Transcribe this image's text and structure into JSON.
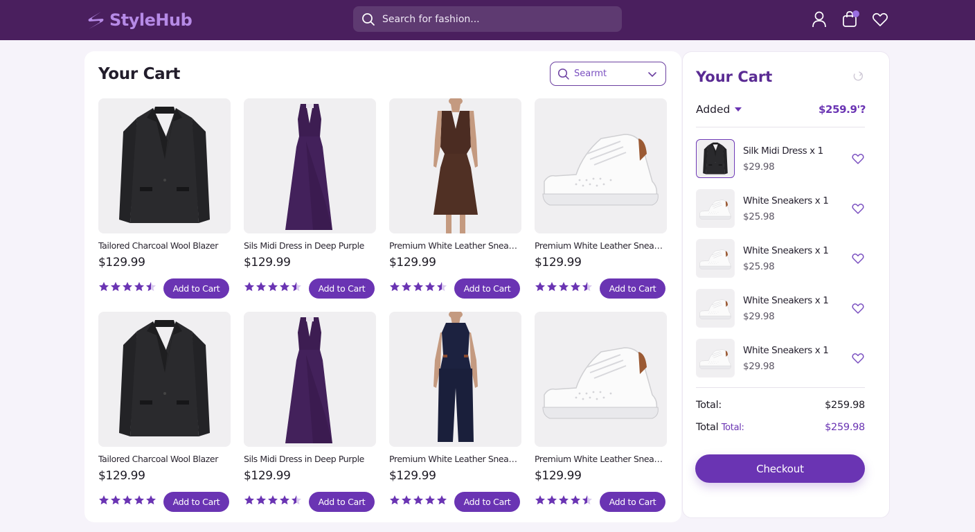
{
  "brand": {
    "name": "StyleHub",
    "accent": "#6a34b3",
    "header_bg": "#4a1f5e"
  },
  "search": {
    "placeholder": "Search for fashion..."
  },
  "header_icons": [
    "user-icon",
    "shopping-bag-icon",
    "heart-icon"
  ],
  "cart_page": {
    "title": "Your Cart",
    "sort_label": "Searmt",
    "products": [
      {
        "name": "Tailored Charcoal Wool Blazer",
        "price": "$129.99",
        "rating": 4.5,
        "image": "blazer",
        "button": "Add to Cart"
      },
      {
        "name": "Sils Midi Dress in Deep Purple",
        "price": "$129.99",
        "rating": 4.5,
        "image": "purple-dress",
        "button": "Add to Cart"
      },
      {
        "name": "Premium White Leather Sneaker...",
        "price": "$129.99",
        "rating": 4.5,
        "image": "brown-dress",
        "button": "Add to Cart"
      },
      {
        "name": "Premium White Leather Sneaker...",
        "price": "$129.99",
        "rating": 4.5,
        "image": "sneaker",
        "button": "Add to Cart"
      },
      {
        "name": "Tailored Charcoal Wool Blazer",
        "price": "$129.99",
        "rating": 5,
        "image": "blazer",
        "button": "Add to Cart"
      },
      {
        "name": "Sils Midi Dress in Deep Purple",
        "price": "$129.99",
        "rating": 4.5,
        "image": "purple-dress",
        "button": "Add to Cart"
      },
      {
        "name": "Premium White Leather Sneaker...",
        "price": "$129.99",
        "rating": 5,
        "image": "navy-outfit",
        "button": "Add to Cart"
      },
      {
        "name": "Premium White Leather Sneaker...",
        "price": "$129.99",
        "rating": 4.5,
        "image": "sneaker",
        "button": "Add to Cart"
      }
    ]
  },
  "side_cart": {
    "title": "Your Cart",
    "filter_label": "Added",
    "subtotal": "$259.9'?",
    "items": [
      {
        "name": "Silk Midi Dress x 1",
        "price": "$29.98",
        "image": "blazer",
        "selected": true
      },
      {
        "name": "White Sneakers x 1",
        "price": "$25.98",
        "image": "sneaker",
        "selected": false
      },
      {
        "name": "White Sneakers x 1",
        "price": "$25.98",
        "image": "sneaker",
        "selected": false
      },
      {
        "name": "White Sneakers x 1",
        "price": "$29.98",
        "image": "sneaker",
        "selected": false
      },
      {
        "name": "White Sneakers x 1",
        "price": "$29.98",
        "image": "sneaker",
        "selected": false
      }
    ],
    "total_label": "Total:",
    "total_value": "$259.98",
    "total2_label_a": "Total",
    "total2_label_b": "Total:",
    "total2_value": "$259.98",
    "checkout_label": "Checkout"
  }
}
